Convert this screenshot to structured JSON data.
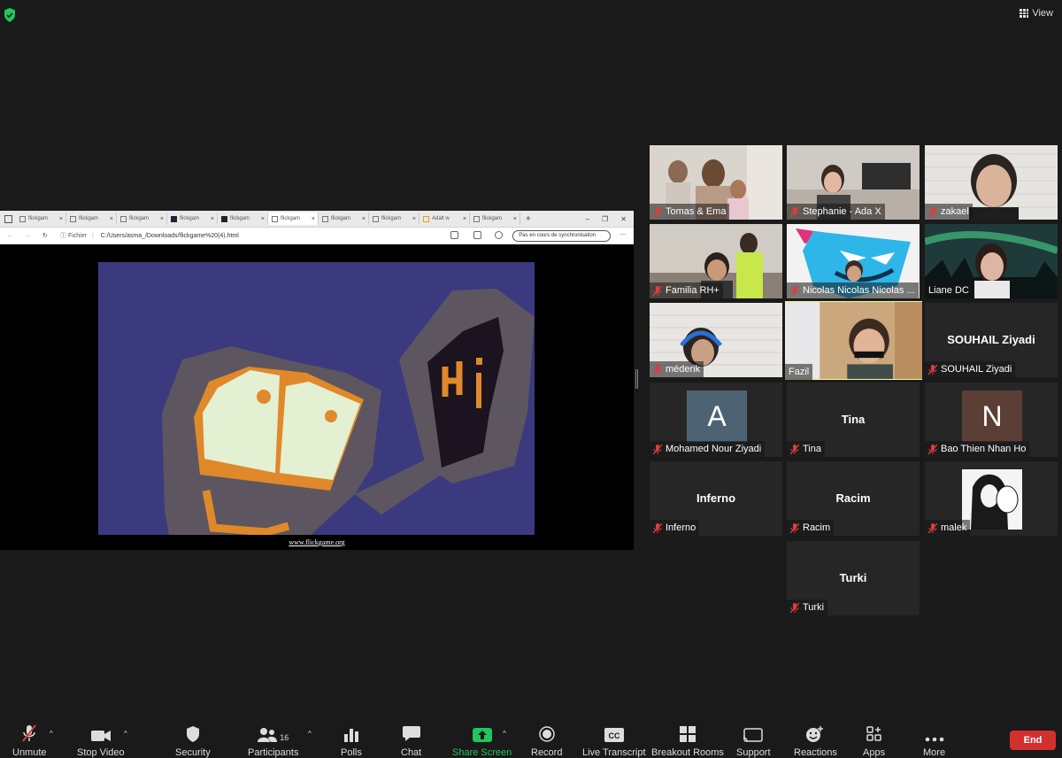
{
  "meeting": {
    "view_label": "View",
    "colors": {
      "muted_red": "#e03c3c",
      "accent_green": "#22c55e",
      "spotlight": "#e9f59b",
      "end": "#d32f2f"
    }
  },
  "shared_screen": {
    "tabs": [
      "flickgam",
      "flickgam",
      "flickgam",
      "flickgam",
      "flickgam",
      "flickgam",
      "flickgam",
      "flickgam",
      "Adalt w",
      "flickgam"
    ],
    "address_label": "Fichier",
    "url": "C:/Users/asma_/Downloads/flickgame%20(4).html",
    "sync_label": "Pas en cours de synchronisation",
    "game_text": "Hi",
    "game_link": "www.flickgame.org"
  },
  "participants": [
    {
      "name": "Tomas & Ema",
      "muted": true
    },
    {
      "name": "Stephanie - Ada X",
      "muted": true
    },
    {
      "name": "zakael",
      "muted": true
    },
    {
      "name": "Familia RH+",
      "muted": true
    },
    {
      "name": "Nicolas Nicolas Nicolas ...",
      "muted": true
    },
    {
      "name": "Liane DC",
      "muted": false
    },
    {
      "name": "méderik",
      "muted": true
    },
    {
      "name": "Fazil",
      "muted": false
    },
    {
      "name": "SOUHAIL  Ziyadi",
      "display": "SOUHAIL  Ziyadi",
      "muted": true
    },
    {
      "name": "Mohamed Nour Ziyadi",
      "avatar_letter": "A",
      "muted": true
    },
    {
      "name": "Tina",
      "display": "Tina",
      "muted": true
    },
    {
      "name": "Bao Thien Nhan Ho",
      "avatar_letter": "N",
      "muted": true
    },
    {
      "name": "Inferno",
      "display": "Inferno",
      "muted": true
    },
    {
      "name": "Racim",
      "display": "Racim",
      "muted": true
    },
    {
      "name": "malek",
      "muted": true
    },
    {
      "name": "Turki",
      "display": "Turki",
      "muted": true
    }
  ],
  "toolbar": {
    "unmute": "Unmute",
    "stop_video": "Stop Video",
    "security": "Security",
    "participants": "Participants",
    "participants_count": "16",
    "polls": "Polls",
    "chat": "Chat",
    "share_screen": "Share Screen",
    "record": "Record",
    "live_transcript": "Live Transcript",
    "breakout_rooms": "Breakout Rooms",
    "support": "Support",
    "reactions": "Reactions",
    "apps": "Apps",
    "more": "More",
    "end": "End"
  }
}
